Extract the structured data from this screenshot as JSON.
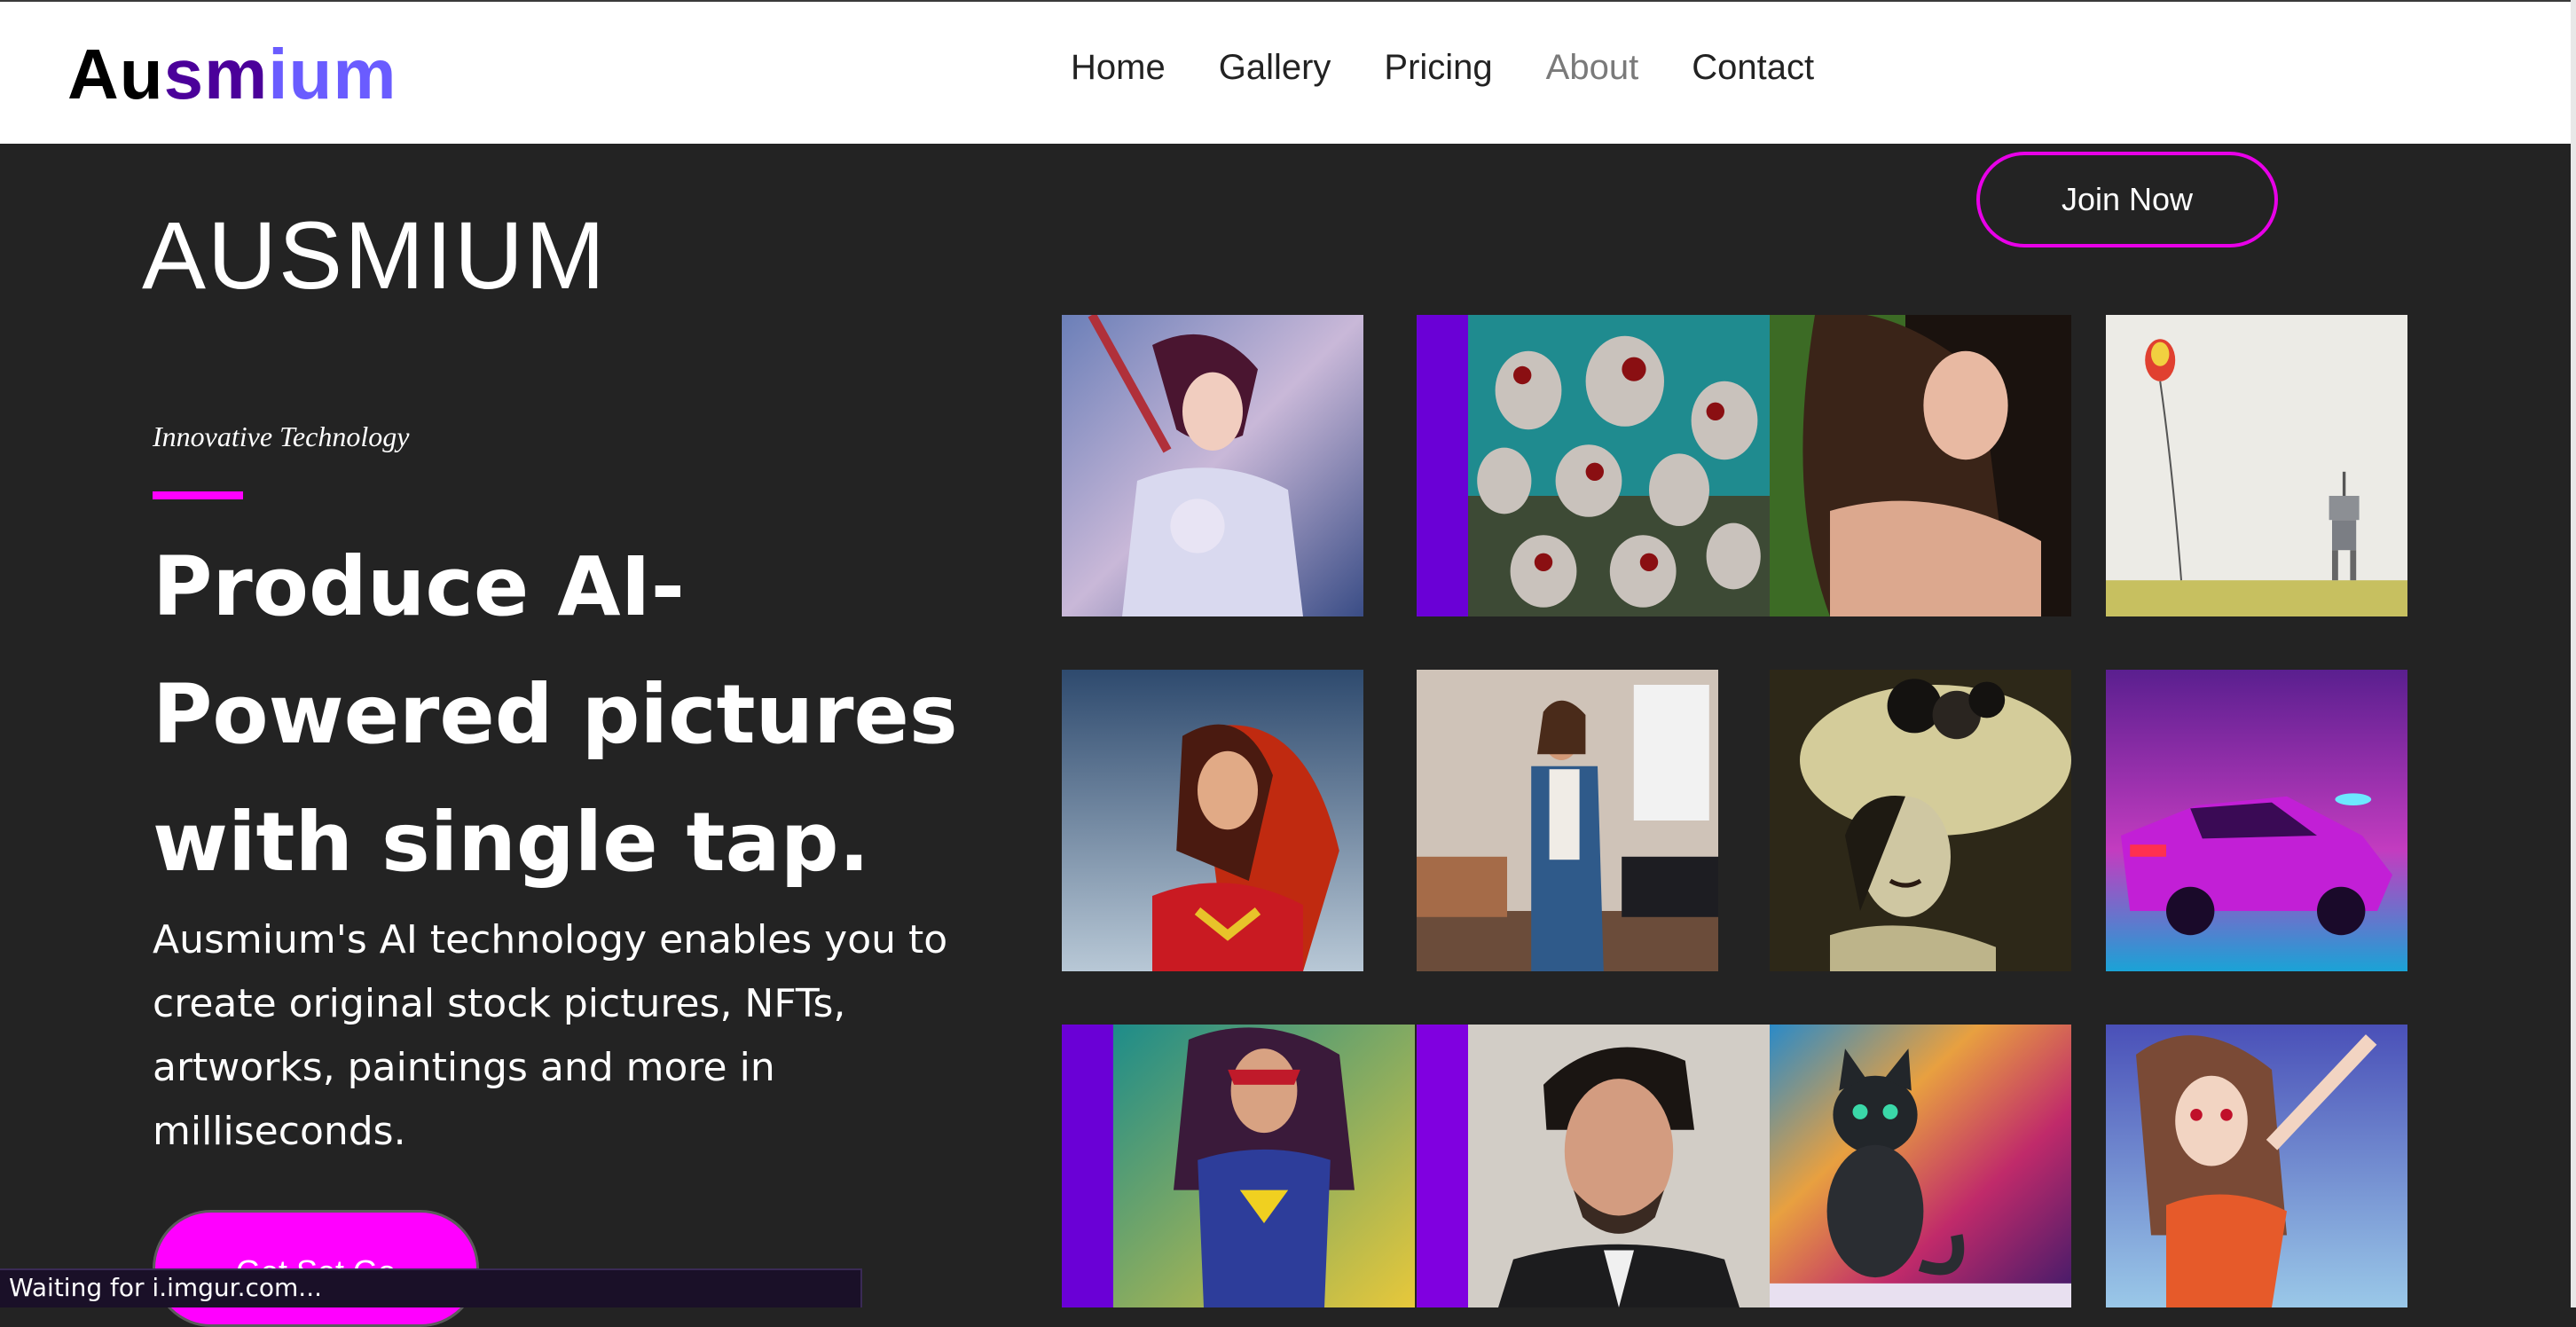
{
  "header": {
    "logo": {
      "part1": "Au",
      "part2": "sm",
      "part3": "ium"
    },
    "nav": [
      {
        "label": "Home"
      },
      {
        "label": "Gallery"
      },
      {
        "label": "Pricing"
      },
      {
        "label": "About"
      },
      {
        "label": "Contact"
      }
    ]
  },
  "hero": {
    "brand_title": "AUSMIUM",
    "tagline": "Innovative Technology",
    "headline": "Produce AI-Powered pictures with single tap.",
    "description": "Ausmium's AI technology enables you to create original stock pictures, NFTs, artworks, paintings and more in milliseconds.",
    "cta_label": "Get Set Go",
    "join_label": "Join Now"
  },
  "gallery": {
    "images": [
      {
        "name": "anime-warrior-image"
      },
      {
        "name": "zombies-image"
      },
      {
        "name": "woman-portrait-image"
      },
      {
        "name": "balloon-robot-image"
      },
      {
        "name": "red-hair-heroine-image"
      },
      {
        "name": "woman-living-room-image"
      },
      {
        "name": "vintage-woman-hat-image"
      },
      {
        "name": "neon-car-image"
      },
      {
        "name": "superhero-woman-image"
      },
      {
        "name": "man-portrait-image"
      },
      {
        "name": "galaxy-cat-image"
      },
      {
        "name": "anime-girl-sky-image"
      }
    ]
  },
  "status_bar": {
    "text": "Waiting for i.imgur.com..."
  },
  "colors": {
    "accent": "#ff00ff",
    "background": "#232323",
    "logo_mid": "#4b009a",
    "logo_end": "#6a5cff"
  }
}
